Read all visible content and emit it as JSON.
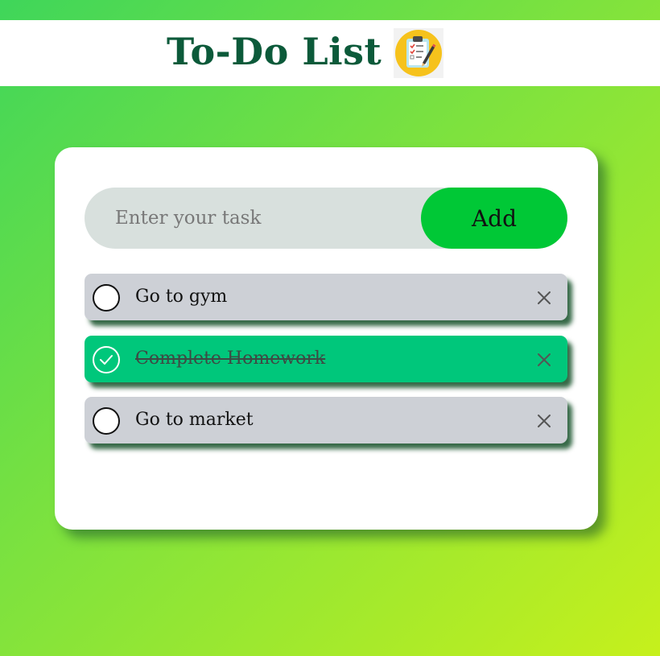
{
  "header": {
    "title": "To-Do List",
    "icon": "clipboard-checklist-icon"
  },
  "task_form": {
    "placeholder": "Enter your task",
    "value": "",
    "add_label": "Add"
  },
  "tasks": [
    {
      "text": "Go to gym",
      "completed": false
    },
    {
      "text": "Complete Homework",
      "completed": true
    },
    {
      "text": "Go to market",
      "completed": false
    }
  ],
  "colors": {
    "title": "#0c5a3a",
    "add_button": "#00c836",
    "task_pending": "#cdd0d6",
    "task_completed": "#00c77b",
    "input_bg": "#d8e0dd"
  }
}
